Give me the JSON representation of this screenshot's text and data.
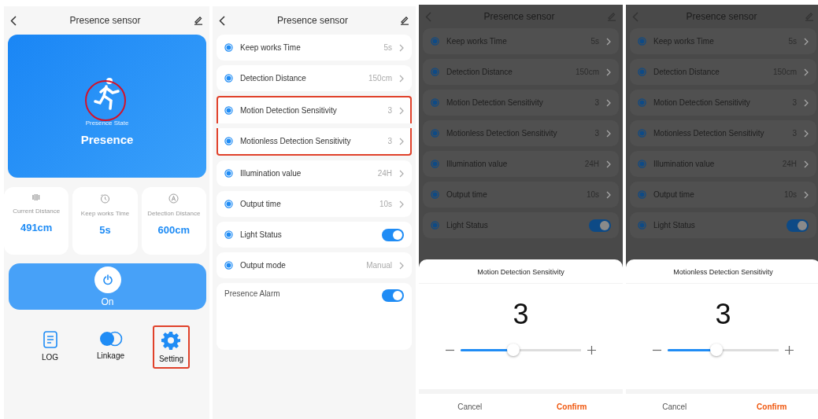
{
  "screens": [
    {
      "kind": "home",
      "title": "Presence sensor",
      "hero": {
        "caption": "Presence State",
        "state": "Presence",
        "icon_circled": true
      },
      "stats": [
        {
          "kind": "bars",
          "label": "Current Distance",
          "value": "491cm"
        },
        {
          "kind": "clock",
          "label": "Keep works Time",
          "value": "5s"
        },
        {
          "kind": "range",
          "label": "Detection Distance",
          "value": "600cm"
        }
      ],
      "power": {
        "label": "On",
        "on": true
      },
      "actions": [
        {
          "kind": "log",
          "label": "LOG",
          "highlighted": false
        },
        {
          "kind": "linkage",
          "label": "Linkage",
          "highlighted": false
        },
        {
          "kind": "setting",
          "label": "Setting",
          "highlighted": true
        }
      ]
    },
    {
      "kind": "settings",
      "title": "Presence sensor",
      "rows": [
        {
          "kind": "value",
          "label": "Keep works Time",
          "value": "5s",
          "highlighted": false
        },
        {
          "kind": "value",
          "label": "Detection Distance",
          "value": "150cm",
          "highlighted": false
        },
        {
          "kind": "value",
          "label": "Motion Detection Sensitivity",
          "value": "3",
          "highlighted": true
        },
        {
          "kind": "value",
          "label": "Motionless Detection Sensitivity",
          "value": "3",
          "highlighted": true
        },
        {
          "kind": "value",
          "label": "Illumination value",
          "value": "24H",
          "highlighted": false
        },
        {
          "kind": "value",
          "label": "Output time",
          "value": "10s",
          "highlighted": false
        },
        {
          "kind": "toggle",
          "label": "Light Status",
          "on": true,
          "highlighted": false
        },
        {
          "kind": "value",
          "label": "Output mode",
          "value": "Manual",
          "highlighted": false
        }
      ],
      "alarm": {
        "label": "Presence Alarm",
        "on": true
      }
    },
    {
      "kind": "dialog",
      "title": "Presence sensor",
      "rows": [
        {
          "kind": "value",
          "label": "Keep works Time",
          "value": "5s",
          "highlighted": false
        },
        {
          "kind": "value",
          "label": "Detection Distance",
          "value": "150cm",
          "highlighted": false
        },
        {
          "kind": "value",
          "label": "Motion Detection Sensitivity",
          "value": "3",
          "highlighted": false
        },
        {
          "kind": "value",
          "label": "Motionless Detection Sensitivity",
          "value": "3",
          "highlighted": false
        },
        {
          "kind": "value",
          "label": "Illumination value",
          "value": "24H",
          "highlighted": false
        },
        {
          "kind": "value",
          "label": "Output time",
          "value": "10s",
          "highlighted": false
        },
        {
          "kind": "toggle",
          "label": "Light Status",
          "on": true,
          "highlighted": false
        }
      ],
      "sheet": {
        "title": "Motion Detection Sensitivity",
        "value": "3",
        "level": 0.44,
        "cancel": "Cancel",
        "confirm": "Confirm"
      }
    },
    {
      "kind": "dialog",
      "title": "Presence sensor",
      "rows": [
        {
          "kind": "value",
          "label": "Keep works Time",
          "value": "5s",
          "highlighted": false
        },
        {
          "kind": "value",
          "label": "Detection Distance",
          "value": "150cm",
          "highlighted": false
        },
        {
          "kind": "value",
          "label": "Motion Detection Sensitivity",
          "value": "3",
          "highlighted": false
        },
        {
          "kind": "value",
          "label": "Motionless Detection Sensitivity",
          "value": "3",
          "highlighted": false
        },
        {
          "kind": "value",
          "label": "Illumination value",
          "value": "24H",
          "highlighted": false
        },
        {
          "kind": "value",
          "label": "Output time",
          "value": "10s",
          "highlighted": false
        },
        {
          "kind": "toggle",
          "label": "Light Status",
          "on": true,
          "highlighted": false
        }
      ],
      "sheet": {
        "title": "Motionless Detection Sensitivity",
        "value": "3",
        "level": 0.44,
        "cancel": "Cancel",
        "confirm": "Confirm"
      }
    }
  ]
}
